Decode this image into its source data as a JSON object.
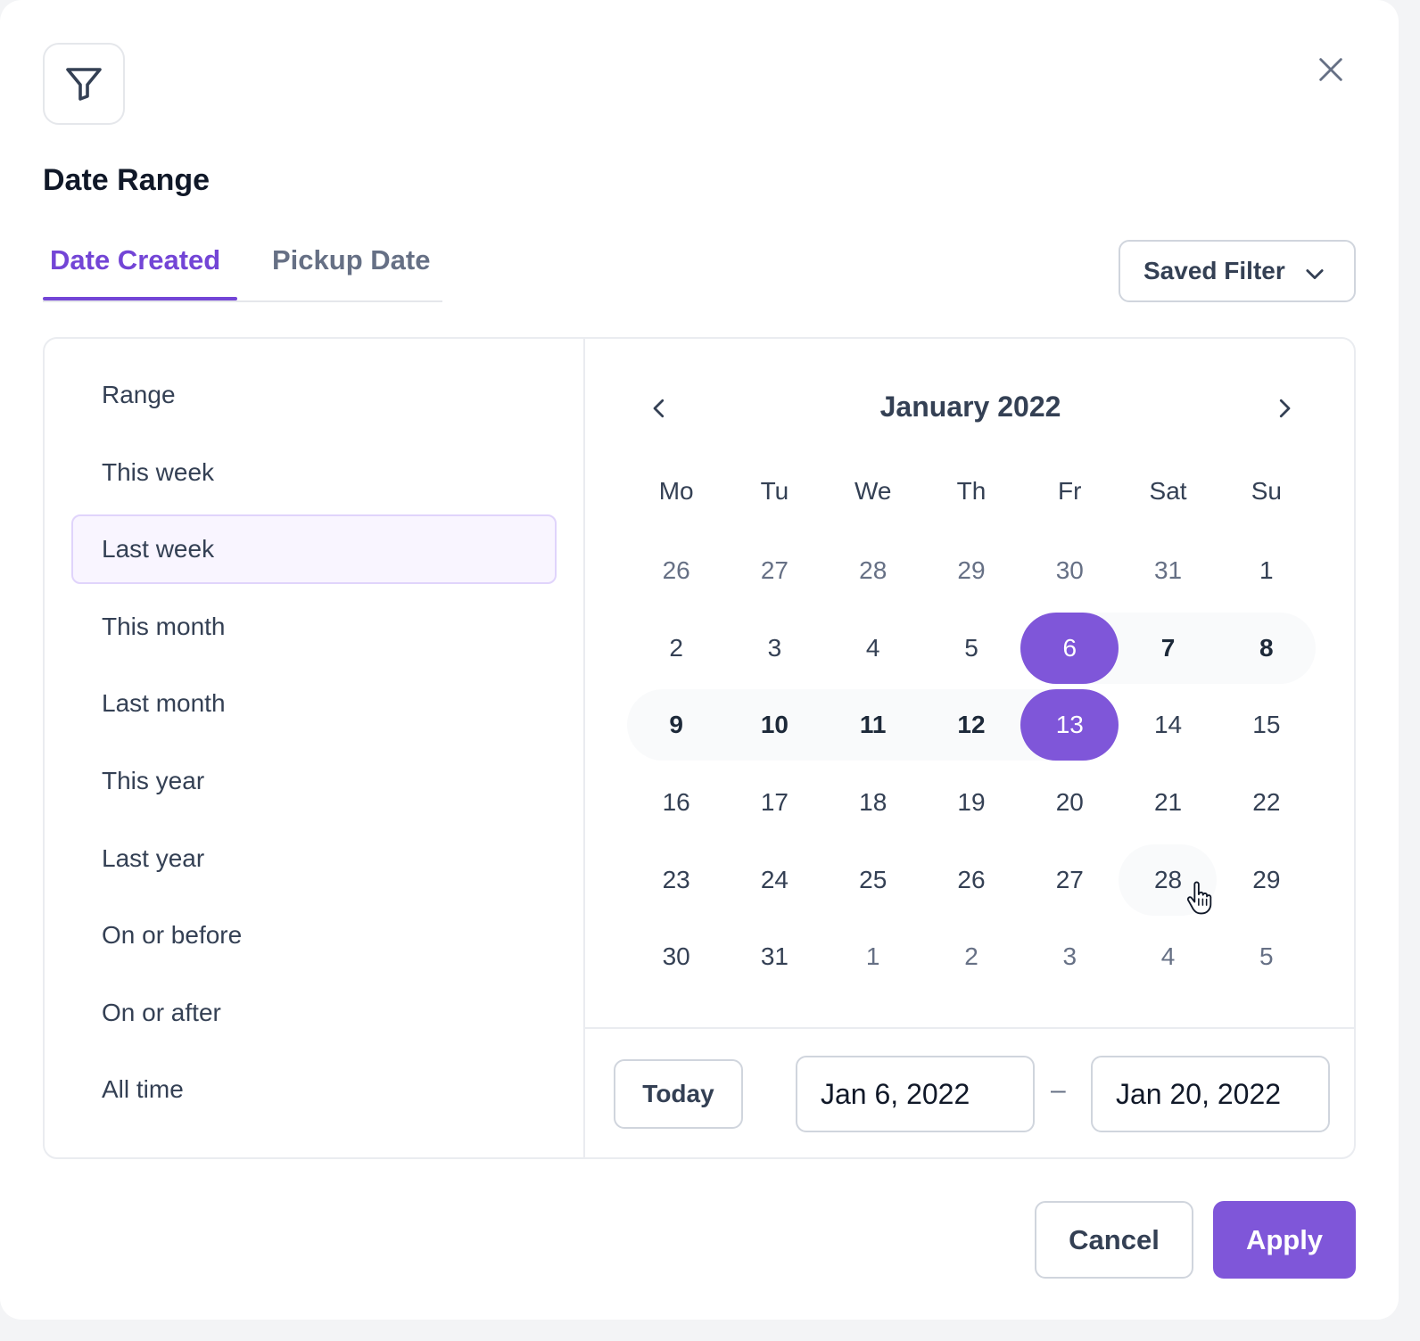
{
  "header": {
    "title": "Date Range",
    "filter_icon": "filter-funnel-icon",
    "close_icon": "close-x-icon"
  },
  "tabs": [
    {
      "label": "Date Created",
      "active": true
    },
    {
      "label": "Pickup Date",
      "active": false
    }
  ],
  "saved_filter": {
    "label": "Saved Filter",
    "icon": "chevron-down-icon"
  },
  "presets": [
    {
      "label": "Range"
    },
    {
      "label": "This week"
    },
    {
      "label": "Last week",
      "selected": true
    },
    {
      "label": "This month"
    },
    {
      "label": "Last month"
    },
    {
      "label": "This year"
    },
    {
      "label": "Last year"
    },
    {
      "label": "On or before"
    },
    {
      "label": "On or after"
    },
    {
      "label": "All time"
    }
  ],
  "calendar": {
    "month_label": "January 2022",
    "weekdays": [
      "Mo",
      "Tu",
      "We",
      "Th",
      "Fr",
      "Sat",
      "Su"
    ],
    "weeks": [
      [
        "26",
        "27",
        "28",
        "29",
        "30",
        "31",
        "1"
      ],
      [
        "2",
        "3",
        "4",
        "5",
        "6",
        "7",
        "8"
      ],
      [
        "9",
        "10",
        "11",
        "12",
        "13",
        "14",
        "15"
      ],
      [
        "16",
        "17",
        "18",
        "19",
        "20",
        "21",
        "22"
      ],
      [
        "23",
        "24",
        "25",
        "26",
        "27",
        "28",
        "29"
      ],
      [
        "30",
        "31",
        "1",
        "2",
        "3",
        "4",
        "5"
      ]
    ],
    "muted_cells": [
      [
        0,
        0
      ],
      [
        0,
        1
      ],
      [
        0,
        2
      ],
      [
        0,
        3
      ],
      [
        0,
        4
      ],
      [
        0,
        5
      ],
      [
        5,
        2
      ],
      [
        5,
        3
      ],
      [
        5,
        4
      ],
      [
        5,
        5
      ],
      [
        5,
        6
      ]
    ],
    "selected_cells": [
      [
        1,
        4
      ],
      [
        2,
        4
      ]
    ],
    "in_range_cells": [
      [
        1,
        5
      ],
      [
        1,
        6
      ],
      [
        2,
        0
      ],
      [
        2,
        1
      ],
      [
        2,
        2
      ],
      [
        2,
        3
      ]
    ],
    "hover_cell": [
      4,
      5
    ],
    "accent_color": "#7f56d9",
    "range_color": "#f9fafb"
  },
  "footer": {
    "today_label": "Today",
    "start_date": "Jan 6, 2022",
    "separator": "–",
    "end_date": "Jan 20, 2022",
    "cancel_label": "Cancel",
    "apply_label": "Apply"
  }
}
